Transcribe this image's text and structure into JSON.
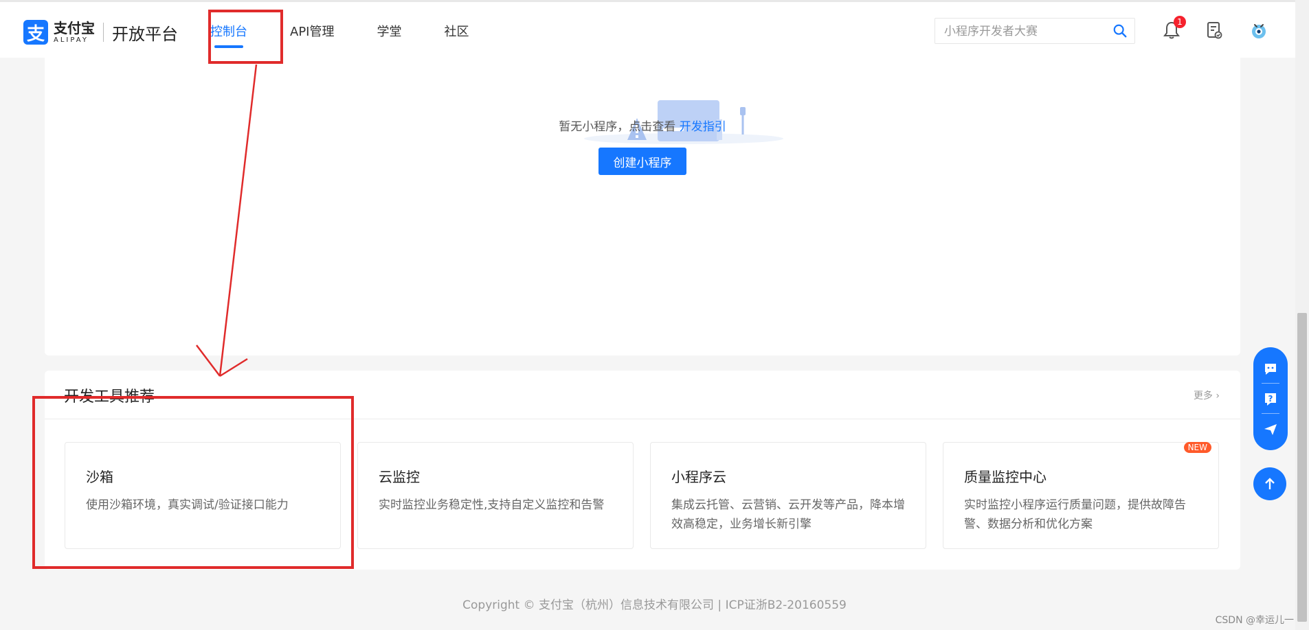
{
  "header": {
    "logo": {
      "cn": "支付宝",
      "en": "ALIPAY",
      "product": "开放平台"
    },
    "nav": [
      {
        "label": "控制台",
        "active": true
      },
      {
        "label": "API管理",
        "active": false
      },
      {
        "label": "学堂",
        "active": false
      },
      {
        "label": "社区",
        "active": false
      }
    ],
    "search": {
      "placeholder": "小程序开发者大赛"
    },
    "notifications": {
      "count": "1"
    },
    "icons": [
      "bell-icon",
      "document-check-icon",
      "avatar-icon"
    ]
  },
  "empty_state": {
    "text": "暂无小程序，点击查看",
    "link": "开发指引",
    "button": "创建小程序"
  },
  "tools_section": {
    "title": "开发工具推荐",
    "more": "更多",
    "items": [
      {
        "name": "沙箱",
        "desc": "使用沙箱环境，真实调试/验证接口能力",
        "badge": ""
      },
      {
        "name": "云监控",
        "desc": "实时监控业务稳定性,支持自定义监控和告警",
        "badge": ""
      },
      {
        "name": "小程序云",
        "desc": "集成云托管、云营销、云开发等产品，降本增效高稳定，业务增长新引擎",
        "badge": ""
      },
      {
        "name": "质量监控中心",
        "desc": "实时监控小程序运行质量问题，提供故障告警、数据分析和优化方案",
        "badge": "NEW"
      }
    ]
  },
  "footer": {
    "copyright": "Copyright © 支付宝（杭州）信息技术有限公司  |  ICP证浙B2-20160559"
  },
  "watermark": "CSDN @幸运儿一",
  "colors": {
    "primary": "#1677ff",
    "annotation": "#e02b2b",
    "badge": "#f5222d",
    "new_badge": "#ff5a2a"
  }
}
